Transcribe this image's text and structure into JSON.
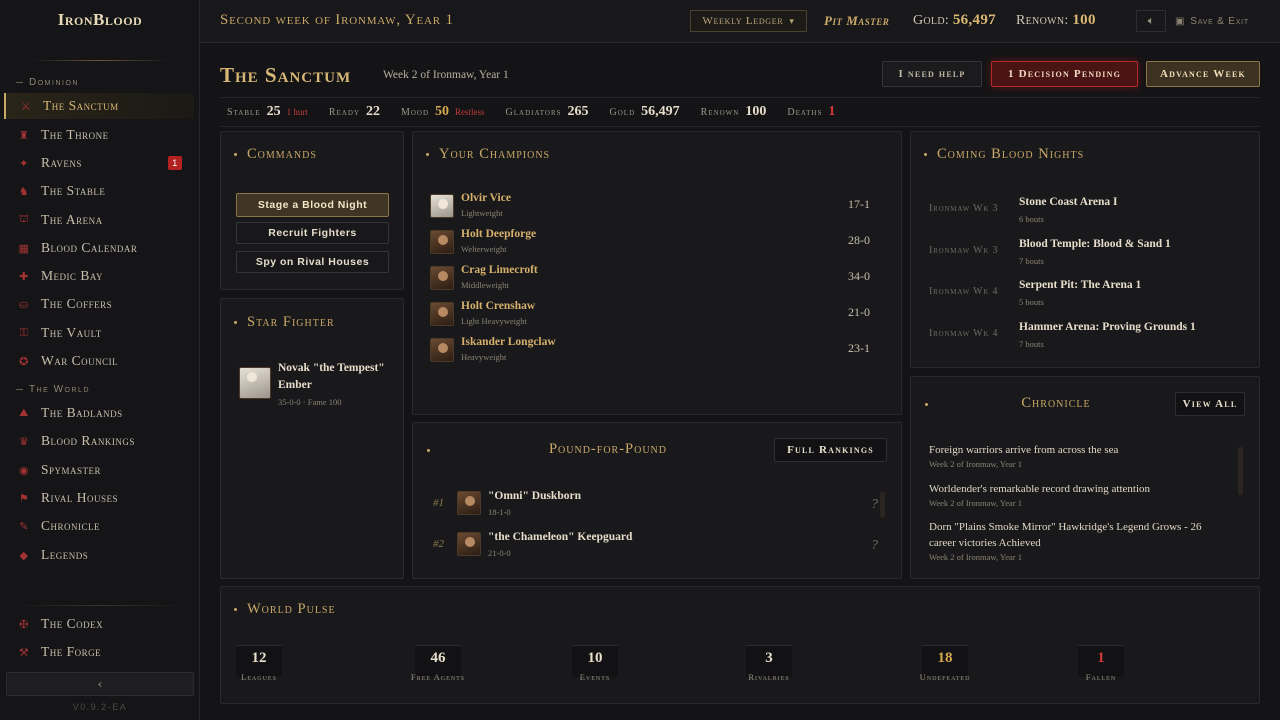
{
  "app": {
    "logo": "IronBlood",
    "version": "V0.9.2-EA"
  },
  "sidebar": {
    "sections": [
      {
        "title": "Dominion"
      },
      {
        "title": "The World"
      }
    ],
    "dominion": [
      {
        "label": "The Sanctum",
        "icon": "helm-icon"
      },
      {
        "label": "The Throne",
        "icon": "throne-icon"
      },
      {
        "label": "Ravens",
        "icon": "raven-icon",
        "badge": "1"
      },
      {
        "label": "The Stable",
        "icon": "horse-icon"
      },
      {
        "label": "The Arena",
        "icon": "arena-icon"
      },
      {
        "label": "Blood Calendar",
        "icon": "calendar-icon"
      },
      {
        "label": "Medic Bay",
        "icon": "medic-icon"
      },
      {
        "label": "The Coffers",
        "icon": "coffers-icon"
      },
      {
        "label": "The Vault",
        "icon": "vault-icon"
      },
      {
        "label": "War Council",
        "icon": "council-icon"
      }
    ],
    "world": [
      {
        "label": "The Badlands",
        "icon": "badlands-icon"
      },
      {
        "label": "Blood Rankings",
        "icon": "rankings-icon"
      },
      {
        "label": "Spymaster",
        "icon": "spy-icon"
      },
      {
        "label": "Rival Houses",
        "icon": "rival-icon"
      },
      {
        "label": "Chronicle",
        "icon": "chronicle-icon"
      },
      {
        "label": "Legends",
        "icon": "legends-icon"
      }
    ],
    "bottom": [
      {
        "label": "The Codex",
        "icon": "codex-icon"
      },
      {
        "label": "The Forge",
        "icon": "forge-icon"
      }
    ]
  },
  "topbar": {
    "week_title": "Second week of Ironmaw, Year 1",
    "ledger": "Weekly Ledger",
    "role": "Pit Master",
    "gold_label": "Gold:",
    "gold_value": "56,497",
    "renown_label": "Renown:",
    "renown_value": "100",
    "save_exit": "Save & Exit"
  },
  "header": {
    "title": "The Sanctum",
    "subtitle": "Week 2 of Ironmaw, Year 1",
    "help": "I need help",
    "pending": "1 Decision Pending",
    "advance": "Advance Week"
  },
  "stats": [
    {
      "label": "Stable",
      "value": "25",
      "note": "1 hurt"
    },
    {
      "label": "Ready",
      "value": "22",
      "note": ""
    },
    {
      "label": "Mood",
      "value": "50",
      "note": "Restless"
    },
    {
      "label": "Gladiators",
      "value": "265",
      "note": ""
    },
    {
      "label": "Gold",
      "value": "56,497",
      "note": ""
    },
    {
      "label": "Renown",
      "value": "100",
      "note": ""
    },
    {
      "label": "Deaths",
      "value": "1",
      "note": ""
    }
  ],
  "commands": {
    "title": "Commands",
    "items": [
      "Stage a Blood Night",
      "Recruit Fighters",
      "Spy on Rival Houses"
    ]
  },
  "star": {
    "title": "Star Fighter",
    "name": "Novak \"the Tempest\"",
    "name2": "Ember",
    "meta": "35-0-0 · Fame 100"
  },
  "champions": {
    "title": "Your Champions",
    "items": [
      {
        "name": "Olvir Vice",
        "class": "Lightweight",
        "record": "17-1"
      },
      {
        "name": "Holt Deepforge",
        "class": "Welterweight",
        "record": "28-0"
      },
      {
        "name": "Crag Limecroft",
        "class": "Middleweight",
        "record": "34-0"
      },
      {
        "name": "Holt Crenshaw",
        "class": "Light Heavyweight",
        "record": "21-0"
      },
      {
        "name": "Iskander Longclaw",
        "class": "Heavyweight",
        "record": "23-1"
      }
    ]
  },
  "p4p": {
    "title": "Pound-for-Pound",
    "button": "Full Rankings",
    "items": [
      {
        "rank": "#1",
        "name": "\"Omni\" Duskborn",
        "record": "18-1-0",
        "q": "?"
      },
      {
        "rank": "#2",
        "name": "\"the Chameleon\" Keepguard",
        "record": "21-0-0",
        "q": "?"
      }
    ]
  },
  "blood_nights": {
    "title": "Coming Blood Nights",
    "items": [
      {
        "week": "Ironmaw Wk 3",
        "name": "Stone Coast Arena I",
        "bouts": "6 bouts"
      },
      {
        "week": "Ironmaw Wk 3",
        "name": "Blood Temple: Blood & Sand 1",
        "bouts": "7 bouts"
      },
      {
        "week": "Ironmaw Wk 4",
        "name": "Serpent Pit: The Arena 1",
        "bouts": "5 bouts"
      },
      {
        "week": "Ironmaw Wk 4",
        "name": "Hammer Arena: Proving Grounds 1",
        "bouts": "7 bouts"
      }
    ]
  },
  "chronicle": {
    "title": "Chronicle",
    "button": "View All",
    "items": [
      {
        "text": "Foreign warriors arrive from across the sea",
        "date": "Week 2 of Ironmaw, Year 1"
      },
      {
        "text": "Worldender's remarkable record drawing attention",
        "date": "Week 2 of Ironmaw, Year 1"
      },
      {
        "text": "Dorn \"Plains Smoke Mirror\" Hawkridge's Legend Grows - 26 career victories Achieved",
        "date": "Week 2 of Ironmaw, Year 1"
      }
    ]
  },
  "world_pulse": {
    "title": "World Pulse",
    "items": [
      {
        "value": "12",
        "label": "Leagues"
      },
      {
        "value": "46",
        "label": "Free Agents"
      },
      {
        "value": "10",
        "label": "Events"
      },
      {
        "value": "3",
        "label": "Rivalries"
      },
      {
        "value": "18",
        "label": "Undefeated"
      },
      {
        "value": "1",
        "label": "Fallen"
      }
    ]
  },
  "colors": {
    "accent": "#c9a868",
    "danger": "#b32121",
    "bg": "#141416"
  }
}
